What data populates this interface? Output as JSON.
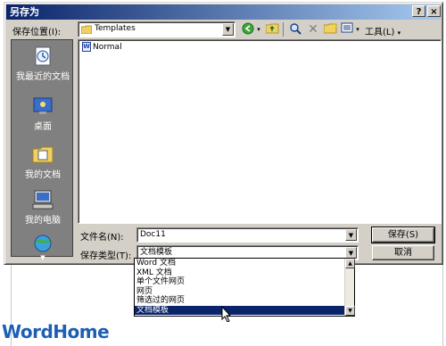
{
  "window": {
    "title": "另存为",
    "help_button": "?",
    "close_button": "×"
  },
  "toolbar": {
    "save_in_label": "保存位置(I):",
    "save_in_value": "Templates",
    "tools_label": "工具(L)"
  },
  "places": [
    {
      "label": "我最近的文档",
      "icon": "recent-documents-icon"
    },
    {
      "label": "桌面",
      "icon": "desktop-icon"
    },
    {
      "label": "我的文档",
      "icon": "my-documents-icon"
    },
    {
      "label": "我的电脑",
      "icon": "my-computer-icon"
    },
    {
      "label": "",
      "icon": "network-places-icon"
    }
  ],
  "files": [
    {
      "name": "Normal",
      "icon": "word-document-icon"
    }
  ],
  "filename": {
    "label": "文件名(N):",
    "value": "Doc11"
  },
  "filetype": {
    "label": "保存类型(T):",
    "value": "文档模板",
    "options": [
      "Word 文档",
      "XML 文档",
      "单个文件网页",
      "网页",
      "筛选过的网页",
      "文档模板"
    ],
    "selected_index": 5
  },
  "buttons": {
    "save": "保存(S)",
    "cancel": "取消"
  },
  "watermark": "WordHome",
  "colors": {
    "title_start": "#0a246a",
    "title_end": "#a6caf0",
    "dialog_bg": "#d4d0c8",
    "selection": "#0a246a",
    "brand": "#1e5fb4"
  }
}
